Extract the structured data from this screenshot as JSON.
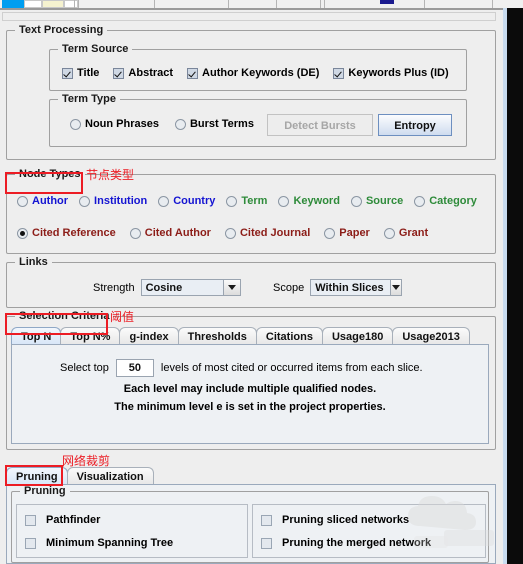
{
  "text_processing": {
    "legend": "Text Processing",
    "term_source": {
      "legend": "Term Source",
      "items": [
        {
          "label": "Title",
          "checked": true
        },
        {
          "label": "Abstract",
          "checked": true
        },
        {
          "label": "Author Keywords (DE)",
          "checked": true
        },
        {
          "label": "Keywords Plus (ID)",
          "checked": true
        }
      ]
    },
    "term_type": {
      "legend": "Term Type",
      "options": [
        {
          "label": "Noun Phrases",
          "selected": false
        },
        {
          "label": "Burst Terms",
          "selected": false
        }
      ],
      "detect_bursts_label": "Detect Bursts",
      "entropy_label": "Entropy"
    }
  },
  "node_types": {
    "legend": "Node Types",
    "annotation_cn": "节点类型",
    "row1": [
      {
        "label": "Author",
        "selected": false,
        "color": "#1414d2"
      },
      {
        "label": "Institution",
        "selected": false,
        "color": "#1414d2"
      },
      {
        "label": "Country",
        "selected": false,
        "color": "#1414d2"
      },
      {
        "label": "Term",
        "selected": false,
        "color": "#2e8b3a"
      },
      {
        "label": "Keyword",
        "selected": false,
        "color": "#2e8b3a"
      },
      {
        "label": "Source",
        "selected": false,
        "color": "#2e8b3a"
      },
      {
        "label": "Category",
        "selected": false,
        "color": "#2e8b3a"
      }
    ],
    "row2": [
      {
        "label": "Cited Reference",
        "selected": true,
        "color": "#8c1d18"
      },
      {
        "label": "Cited Author",
        "selected": false,
        "color": "#8c1d18"
      },
      {
        "label": "Cited Journal",
        "selected": false,
        "color": "#8c1d18"
      },
      {
        "label": "Paper",
        "selected": false,
        "color": "#8c1d18"
      },
      {
        "label": "Grant",
        "selected": false,
        "color": "#8c1d18"
      }
    ]
  },
  "links": {
    "legend": "Links",
    "strength_label": "Strength",
    "strength_value": "Cosine",
    "scope_label": "Scope",
    "scope_value": "Within Slices"
  },
  "selection_criteria": {
    "legend": "Selection Criteria",
    "annotation_cn": "阈值",
    "tabs": [
      {
        "label": "Top N",
        "active": true
      },
      {
        "label": "Top N%",
        "active": false
      },
      {
        "label": "g-index",
        "active": false
      },
      {
        "label": "Thresholds",
        "active": false
      },
      {
        "label": "Citations",
        "active": false
      },
      {
        "label": "Usage180",
        "active": false
      },
      {
        "label": "Usage2013",
        "active": false
      }
    ],
    "select_top_label": "Select top",
    "select_top_value": "50",
    "select_top_suffix": "levels of most cited or occurred items from each slice.",
    "line2": "Each level may include multiple qualified nodes.",
    "line3": "The minimum level e is set in the project properties."
  },
  "bottom": {
    "annotation_cn": "网络裁剪",
    "tabs": [
      {
        "label": "Pruning",
        "active": true
      },
      {
        "label": "Visualization",
        "active": false
      }
    ],
    "pruning": {
      "legend": "Pruning",
      "left": [
        {
          "label": "Pathfinder",
          "checked": false
        },
        {
          "label": "Minimum Spanning Tree",
          "checked": false
        }
      ],
      "right": [
        {
          "label": "Pruning sliced networks",
          "checked": false
        },
        {
          "label": "Pruning the merged network",
          "checked": false
        }
      ]
    }
  }
}
